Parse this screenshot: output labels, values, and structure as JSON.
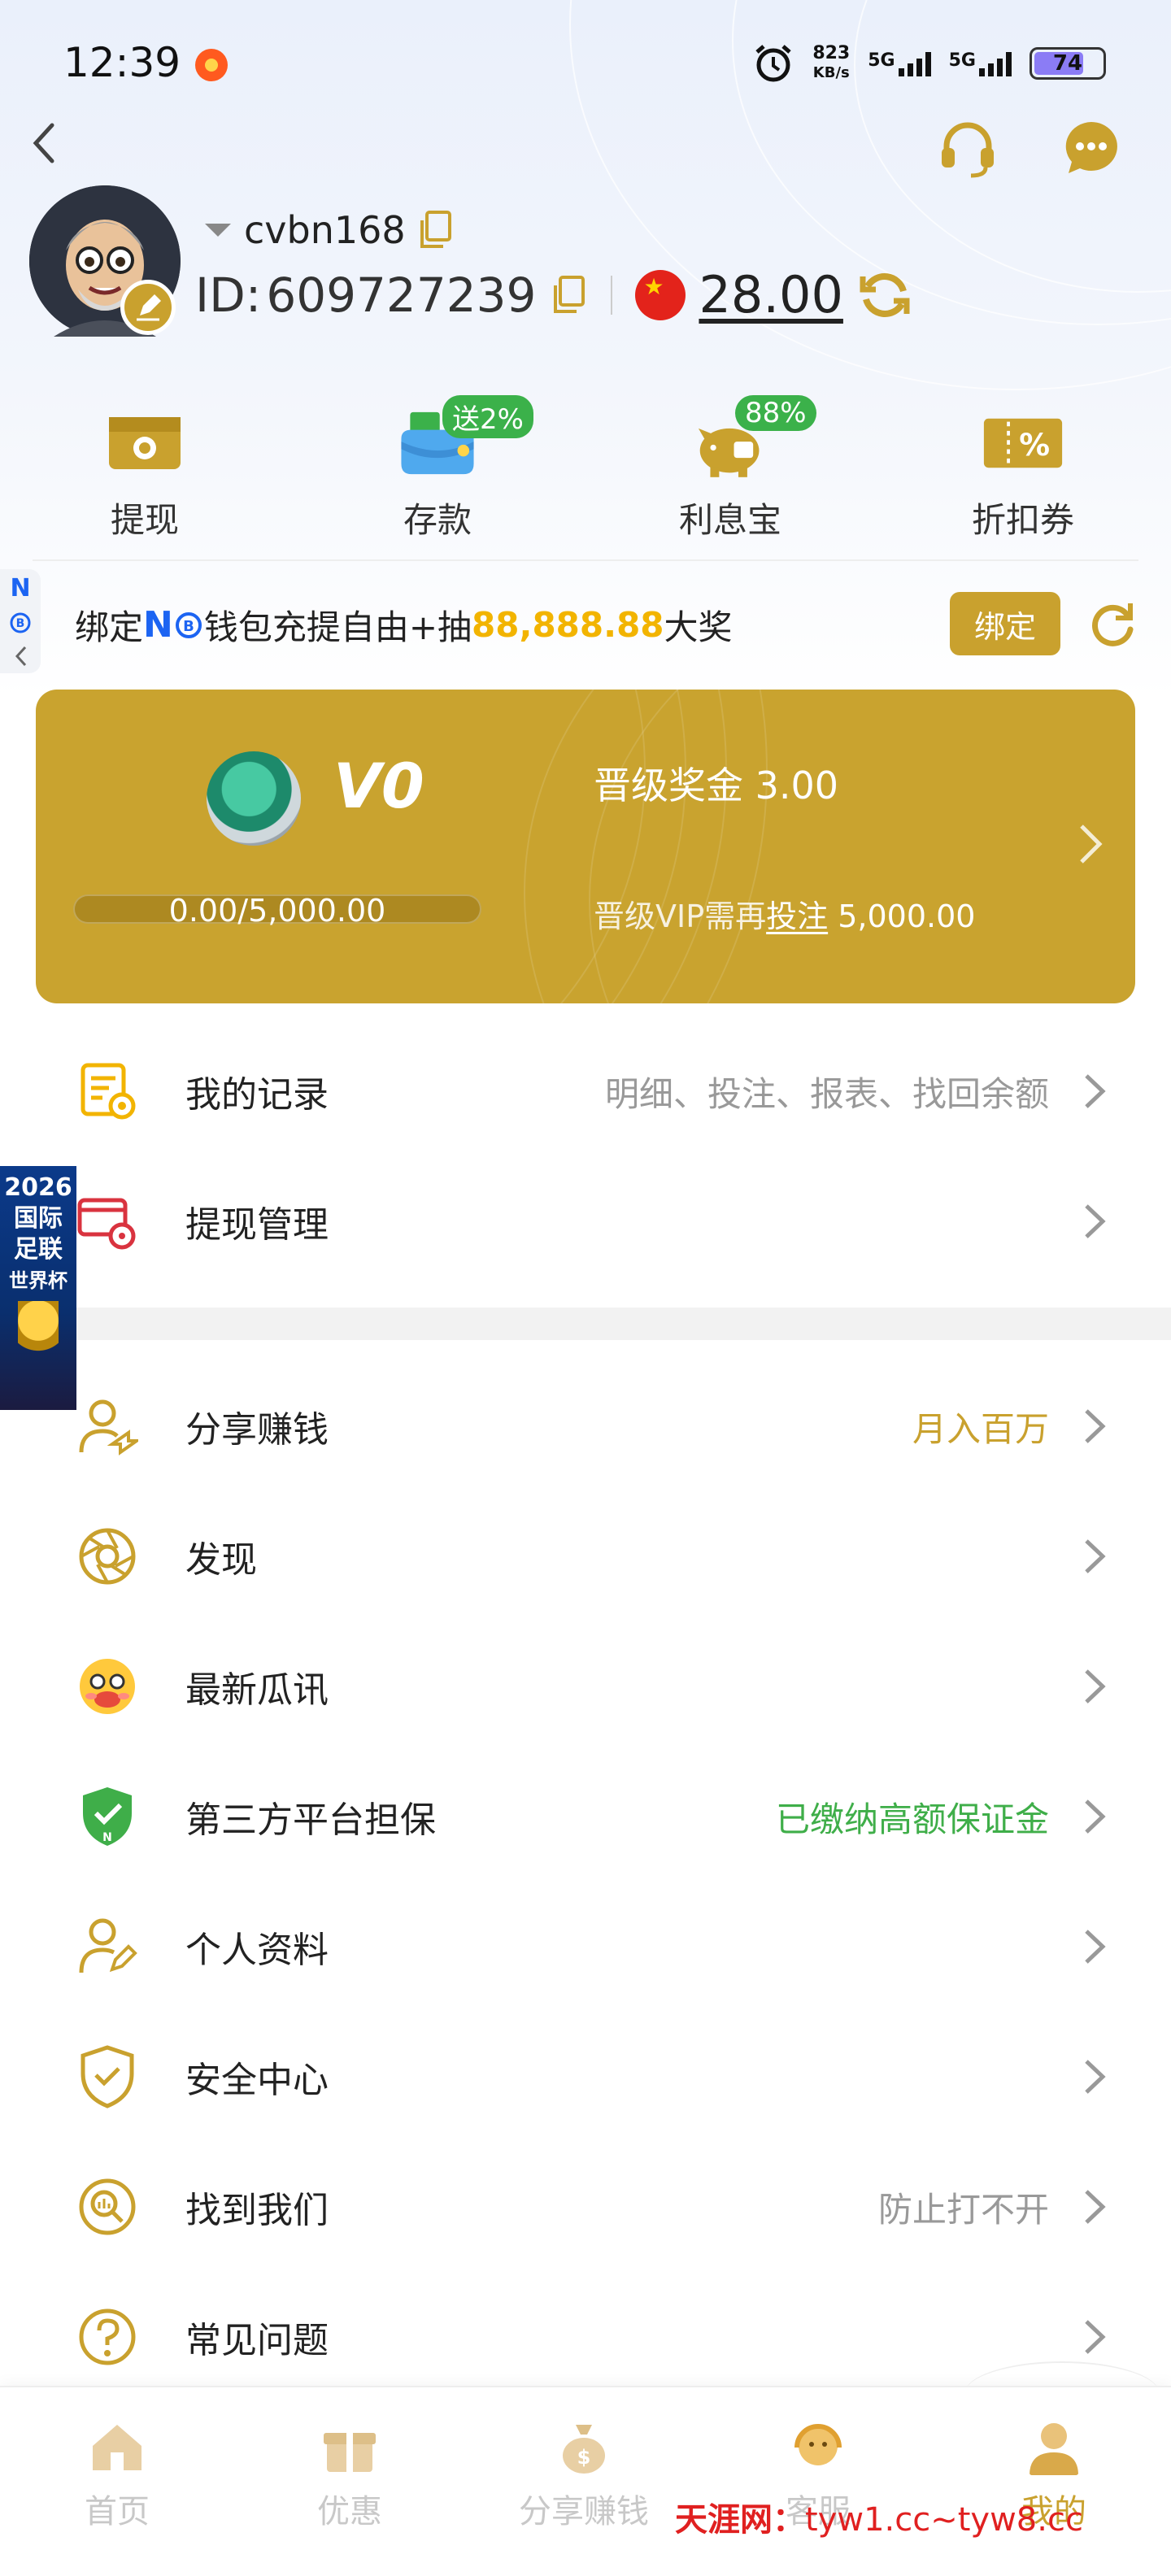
{
  "status_bar": {
    "time": "12:39",
    "net_speed_value": "823",
    "net_speed_unit": "KB/s",
    "sim1": "5G",
    "sim2": "5G",
    "battery": "74"
  },
  "profile": {
    "username": "cvbn168",
    "id_prefix": "ID:",
    "id_value": "609727239",
    "balance": "28.00"
  },
  "quick_actions": [
    {
      "label": "提现",
      "icon": "withdraw-cash-icon",
      "badge": ""
    },
    {
      "label": "存款",
      "icon": "deposit-wallet-icon",
      "badge": "送2%"
    },
    {
      "label": "利息宝",
      "icon": "piggy-bank-icon",
      "badge": "88%"
    },
    {
      "label": "折扣券",
      "icon": "discount-coupon-icon",
      "badge": ""
    }
  ],
  "bind_banner": {
    "prefix": "绑定 ",
    "brand": "N",
    "middle": " 钱包充提自由+抽",
    "amount": "88,888.88",
    "suffix": "大奖",
    "button": "绑定"
  },
  "side_tab": {
    "letter": "N"
  },
  "vip": {
    "level": "V0",
    "bonus": "晋级奖金 3.00",
    "progress_text": "0.00/5,000.00",
    "progress_fraction": 0,
    "need_prefix": "晋级VIP需再",
    "need_link": "投注",
    "need_amount": " 5,000.00"
  },
  "menu_group1": [
    {
      "label": "我的记录",
      "hint": "明细、投注、报表、找回余额",
      "hint_color": "grey",
      "icon": "records-icon"
    },
    {
      "label": "提现管理",
      "hint": "",
      "hint_color": "grey",
      "icon": "withdraw-manage-icon"
    }
  ],
  "menu_group2": [
    {
      "label": "分享赚钱",
      "hint": "月入百万",
      "hint_color": "gold",
      "icon": "share-earn-icon"
    },
    {
      "label": "发现",
      "hint": "",
      "hint_color": "grey",
      "icon": "discover-aperture-icon"
    },
    {
      "label": "最新瓜讯",
      "hint": "",
      "hint_color": "grey",
      "icon": "news-emoji-icon"
    },
    {
      "label": "第三方平台担保",
      "hint": "已缴纳高额保证金",
      "hint_color": "green",
      "icon": "guarantee-shield-icon"
    },
    {
      "label": "个人资料",
      "hint": "",
      "hint_color": "grey",
      "icon": "profile-edit-icon"
    },
    {
      "label": "安全中心",
      "hint": "",
      "hint_color": "grey",
      "icon": "security-shield-icon"
    },
    {
      "label": "找到我们",
      "hint": "防止打不开",
      "hint_color": "grey",
      "icon": "find-us-icon"
    },
    {
      "label": "常见问题",
      "hint": "",
      "hint_color": "grey",
      "icon": "faq-question-icon"
    }
  ],
  "worldcup_banner": {
    "line1": "2026",
    "line2": "国际",
    "line3": "足联",
    "line4": "世界杯"
  },
  "bottom_nav": [
    {
      "label": "首页",
      "icon": "home-icon",
      "active": false
    },
    {
      "label": "优惠",
      "icon": "gift-icon",
      "active": false
    },
    {
      "label": "分享赚钱",
      "icon": "money-bag-icon",
      "active": false
    },
    {
      "label": "客服",
      "icon": "customer-service-icon",
      "active": false
    },
    {
      "label": "我的",
      "icon": "user-profile-icon",
      "active": true
    }
  ],
  "watermark": {
    "site": "天涯网：",
    "urls": "tyw1.cc~tyw8.cc"
  },
  "colors": {
    "gold": "#c9a12e",
    "green": "#3fae49",
    "amount_yellow": "#f2b400"
  }
}
